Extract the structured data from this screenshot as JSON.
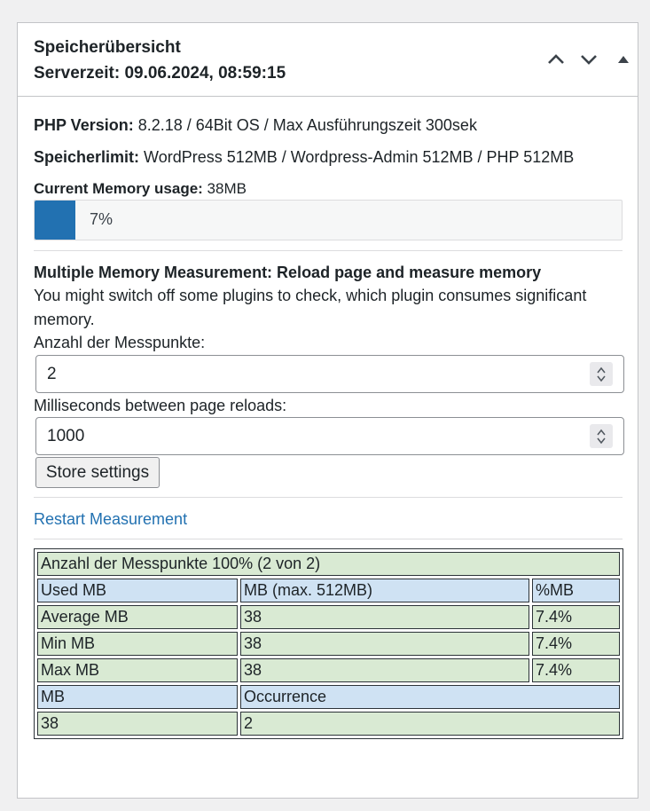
{
  "header": {
    "title": "Speicherübersicht",
    "server_time": "Serverzeit: 09.06.2024, 08:59:15"
  },
  "info": {
    "php_label": "PHP Version:",
    "php_value": " 8.2.18 / 64Bit OS / Max Ausführungszeit 300sek",
    "limit_label": "Speicherlimit:",
    "limit_value": " WordPress 512MB / Wordpress-Admin 512MB / PHP 512MB",
    "usage_label": "Current Memory usage:",
    "usage_value": " 38MB",
    "usage_percent_text": "7%",
    "usage_fraction": 0.07
  },
  "measurement": {
    "heading": "Multiple Memory Measurement: Reload page and measure memory",
    "desc_line1": "You might switch off some plugins to check, which plugin consumes significant",
    "desc_line2": "memory.",
    "points_label": "Anzahl der Messpunkte:",
    "points_value": "2",
    "interval_label": "Milliseconds between page reloads:",
    "interval_value": "1000",
    "store_button": "Store settings",
    "restart_link": "Restart Measurement"
  },
  "results": {
    "title": "Anzahl der Messpunkte 100% (2 von 2)",
    "header": [
      "Used MB",
      "MB (max. 512MB)",
      "%MB"
    ],
    "rows": [
      [
        "Average MB",
        "38",
        "7.4%"
      ],
      [
        "Min MB",
        "38",
        "7.4%"
      ],
      [
        "Max MB",
        "38",
        "7.4%"
      ]
    ],
    "occ_header": [
      "MB",
      "Occurrence"
    ],
    "occ_row": [
      "38",
      "2"
    ]
  },
  "colors": {
    "accent": "#2271b1",
    "green_cell": "#d9ead3",
    "blue_cell": "#cfe2f3"
  },
  "icons": [
    "chevron-up-icon",
    "chevron-down-icon",
    "caret-up-icon",
    "spinner-icon"
  ]
}
